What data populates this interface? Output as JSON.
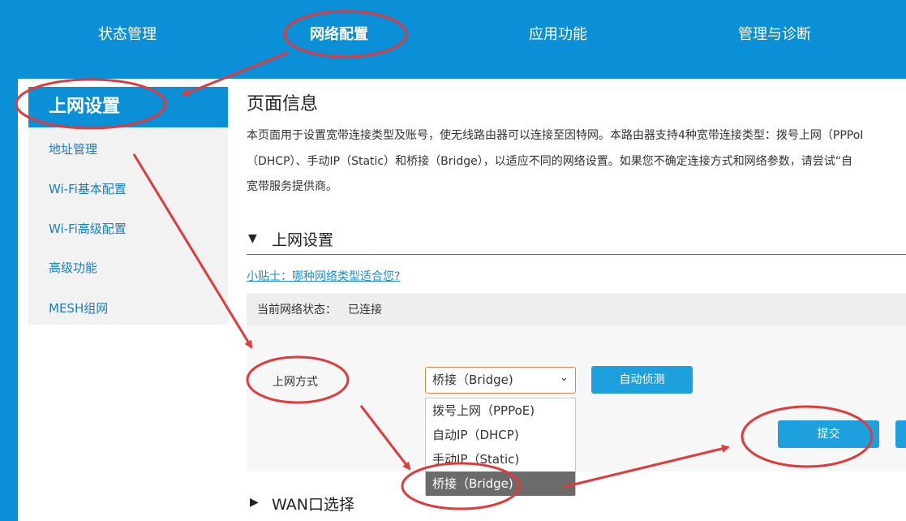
{
  "nav": {
    "items": [
      "状态管理",
      "网络配置",
      "应用功能",
      "管理与诊断"
    ]
  },
  "sidebar": {
    "header": "上网设置",
    "items": [
      "地址管理",
      "Wi-Fi基本配置",
      "Wi-Fi高级配置",
      "高级功能",
      "MESH组网"
    ]
  },
  "main": {
    "title": "页面信息",
    "desc_lines": [
      "本页面用于设置宽带连接类型及账号，使无线路由器可以连接至因特网。本路由器支持4种宽带连接类型：拨号上网（PPPoI",
      "（DHCP）、手动IP（Static）和桥接（Bridge），以适应不同的网络设置。如果您不确定连接方式和网络参数，请尝试“自",
      "宽带服务提供商。"
    ],
    "section1": {
      "arrow": "▼",
      "title": "上网设置"
    },
    "tip_link": "小贴士：哪种网络类型适合您?",
    "status": {
      "label": "当前网络状态：",
      "value": "已连接"
    },
    "form": {
      "mode_label": "上网方式",
      "select_value": "桥接（Bridge)",
      "options": [
        "拨号上网（PPPoE)",
        "自动IP（DHCP)",
        "手动IP（Static)",
        "桥接（Bridge)"
      ],
      "selected_index": 3,
      "detect_button": "自动侦测",
      "submit_button": "提交"
    },
    "section2": {
      "arrow": "▶",
      "title": "WAN口选择"
    }
  },
  "colors": {
    "brand_blue": "#0b8fd6",
    "button_blue": "#1ea0df",
    "annotation_red": "#e03a3a"
  }
}
